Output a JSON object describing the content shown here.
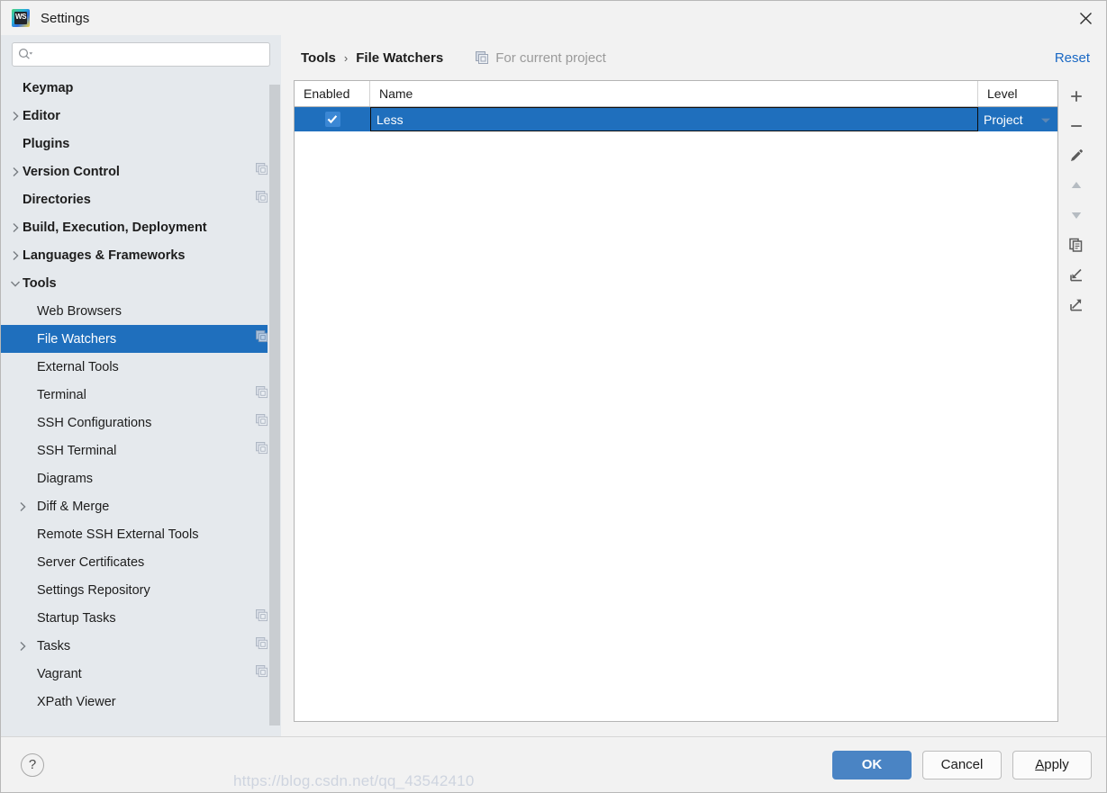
{
  "window": {
    "title": "Settings",
    "app_icon": "webstorm-icon",
    "close_icon": "close-icon"
  },
  "search": {
    "value": "",
    "placeholder": "",
    "icon": "search-icon"
  },
  "sidebar": {
    "scope_icon": "project-scope-icon",
    "items": [
      {
        "label": "Keymap",
        "level": 0,
        "arrow": "none",
        "scope": false,
        "selected": false
      },
      {
        "label": "Editor",
        "level": 0,
        "arrow": "collapsed",
        "scope": false,
        "selected": false
      },
      {
        "label": "Plugins",
        "level": 0,
        "arrow": "none",
        "scope": false,
        "selected": false
      },
      {
        "label": "Version Control",
        "level": 0,
        "arrow": "collapsed",
        "scope": true,
        "selected": false
      },
      {
        "label": "Directories",
        "level": 0,
        "arrow": "none",
        "scope": true,
        "selected": false
      },
      {
        "label": "Build, Execution, Deployment",
        "level": 0,
        "arrow": "collapsed",
        "scope": false,
        "selected": false
      },
      {
        "label": "Languages & Frameworks",
        "level": 0,
        "arrow": "collapsed",
        "scope": false,
        "selected": false
      },
      {
        "label": "Tools",
        "level": 0,
        "arrow": "expanded",
        "scope": false,
        "selected": false
      },
      {
        "label": "Web Browsers",
        "level": 1,
        "arrow": "none",
        "scope": false,
        "selected": false
      },
      {
        "label": "File Watchers",
        "level": 1,
        "arrow": "none",
        "scope": true,
        "selected": true
      },
      {
        "label": "External Tools",
        "level": 1,
        "arrow": "none",
        "scope": false,
        "selected": false
      },
      {
        "label": "Terminal",
        "level": 1,
        "arrow": "none",
        "scope": true,
        "selected": false
      },
      {
        "label": "SSH Configurations",
        "level": 1,
        "arrow": "none",
        "scope": true,
        "selected": false
      },
      {
        "label": "SSH Terminal",
        "level": 1,
        "arrow": "none",
        "scope": true,
        "selected": false
      },
      {
        "label": "Diagrams",
        "level": 1,
        "arrow": "none",
        "scope": false,
        "selected": false
      },
      {
        "label": "Diff & Merge",
        "level": 1,
        "arrow": "collapsed",
        "scope": false,
        "selected": false
      },
      {
        "label": "Remote SSH External Tools",
        "level": 1,
        "arrow": "none",
        "scope": false,
        "selected": false
      },
      {
        "label": "Server Certificates",
        "level": 1,
        "arrow": "none",
        "scope": false,
        "selected": false
      },
      {
        "label": "Settings Repository",
        "level": 1,
        "arrow": "none",
        "scope": false,
        "selected": false
      },
      {
        "label": "Startup Tasks",
        "level": 1,
        "arrow": "none",
        "scope": true,
        "selected": false
      },
      {
        "label": "Tasks",
        "level": 1,
        "arrow": "collapsed",
        "scope": true,
        "selected": false
      },
      {
        "label": "Vagrant",
        "level": 1,
        "arrow": "none",
        "scope": true,
        "selected": false
      },
      {
        "label": "XPath Viewer",
        "level": 1,
        "arrow": "none",
        "scope": false,
        "selected": false
      }
    ]
  },
  "header": {
    "breadcrumb_parent": "Tools",
    "breadcrumb_separator": "›",
    "breadcrumb_current": "File Watchers",
    "scope_label": "For current project",
    "scope_icon": "project-scope-icon",
    "reset_label": "Reset"
  },
  "table": {
    "columns": [
      "Enabled",
      "Name",
      "Level"
    ],
    "rows": [
      {
        "enabled": true,
        "name": "Less",
        "level": "Project",
        "selected": true
      }
    ]
  },
  "toolbar": {
    "buttons": [
      {
        "name": "add-button",
        "icon": "plus-icon",
        "enabled": true
      },
      {
        "name": "remove-button",
        "icon": "minus-icon",
        "enabled": true
      },
      {
        "name": "edit-button",
        "icon": "pencil-icon",
        "enabled": true
      },
      {
        "name": "move-up-button",
        "icon": "arrow-up-icon",
        "enabled": false
      },
      {
        "name": "move-down-button",
        "icon": "arrow-down-icon",
        "enabled": false
      },
      {
        "name": "copy-button",
        "icon": "copy-icon",
        "enabled": true
      },
      {
        "name": "import-button",
        "icon": "import-icon",
        "enabled": true
      },
      {
        "name": "export-button",
        "icon": "export-icon",
        "enabled": true
      }
    ]
  },
  "footer": {
    "help_label": "?",
    "ok_label": "OK",
    "cancel_label": "Cancel",
    "apply_label": "Apply",
    "apply_mnemonic": "A",
    "apply_rest": "pply"
  },
  "watermark": {
    "text": "https://blog.csdn.net/qq_43542410"
  },
  "colors": {
    "accent": "#1f6fbd",
    "sidebar_bg": "#e5e9ed",
    "panel_bg": "#f2f2f2",
    "link": "#1a68c4",
    "ok_button": "#4a84c4"
  }
}
